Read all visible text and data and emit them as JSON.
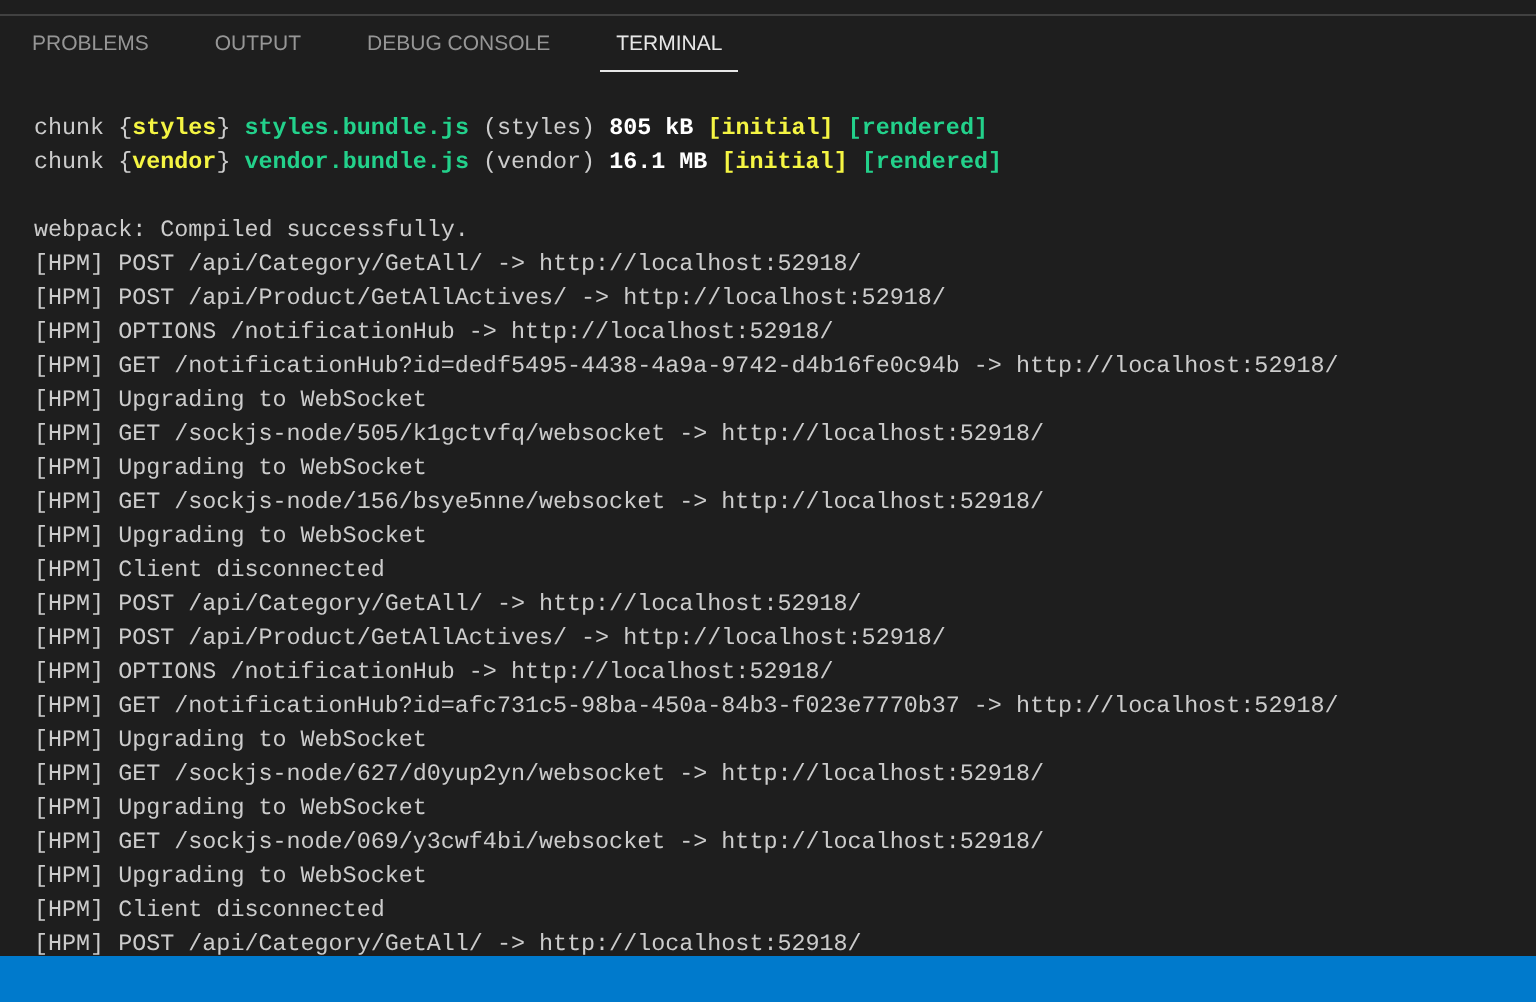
{
  "panel_tabs": [
    {
      "label": "PROBLEMS",
      "selected": false
    },
    {
      "label": "OUTPUT",
      "selected": false
    },
    {
      "label": "DEBUG CONSOLE",
      "selected": false
    },
    {
      "label": "TERMINAL",
      "selected": true
    }
  ],
  "terminal": {
    "blocks": [
      [
        [
          {
            "text": "chunk {",
            "kind": "plain"
          },
          {
            "text": "styles",
            "kind": "name"
          },
          {
            "text": "} ",
            "kind": "plain"
          },
          {
            "text": "styles.bundle.js",
            "kind": "file"
          },
          {
            "text": " (styles) ",
            "kind": "plain"
          },
          {
            "text": "805 kB",
            "kind": "size"
          },
          {
            "text": " [initial]",
            "kind": "initial"
          },
          {
            "text": " [rendered]",
            "kind": "rendered"
          }
        ],
        [
          {
            "text": "chunk {",
            "kind": "plain"
          },
          {
            "text": "vendor",
            "kind": "name"
          },
          {
            "text": "} ",
            "kind": "plain"
          },
          {
            "text": "vendor.bundle.js",
            "kind": "file"
          },
          {
            "text": " (vendor) ",
            "kind": "plain"
          },
          {
            "text": "16.1 MB",
            "kind": "size"
          },
          {
            "text": " [initial]",
            "kind": "initial"
          },
          {
            "text": " [rendered]",
            "kind": "rendered"
          }
        ]
      ],
      [
        [
          {
            "text": "webpack: Compiled successfully.",
            "kind": "plain"
          }
        ],
        [
          {
            "text": "[HPM] POST /api/Category/GetAll/ -> http://localhost:52918/",
            "kind": "plain"
          }
        ],
        [
          {
            "text": "[HPM] POST /api/Product/GetAllActives/ -> http://localhost:52918/",
            "kind": "plain"
          }
        ],
        [
          {
            "text": "[HPM] OPTIONS /notificationHub -> http://localhost:52918/",
            "kind": "plain"
          }
        ],
        [
          {
            "text": "[HPM] GET /notificationHub?id=dedf5495-4438-4a9a-9742-d4b16fe0c94b -> http://localhost:52918/",
            "kind": "plain"
          }
        ],
        [
          {
            "text": "[HPM] Upgrading to WebSocket",
            "kind": "plain"
          }
        ],
        [
          {
            "text": "[HPM] GET /sockjs-node/505/k1gctvfq/websocket -> http://localhost:52918/",
            "kind": "plain"
          }
        ],
        [
          {
            "text": "[HPM] Upgrading to WebSocket",
            "kind": "plain"
          }
        ],
        [
          {
            "text": "[HPM] GET /sockjs-node/156/bsye5nne/websocket -> http://localhost:52918/",
            "kind": "plain"
          }
        ],
        [
          {
            "text": "[HPM] Upgrading to WebSocket",
            "kind": "plain"
          }
        ],
        [
          {
            "text": "[HPM] Client disconnected",
            "kind": "plain"
          }
        ],
        [
          {
            "text": "[HPM] POST /api/Category/GetAll/ -> http://localhost:52918/",
            "kind": "plain"
          }
        ],
        [
          {
            "text": "[HPM] POST /api/Product/GetAllActives/ -> http://localhost:52918/",
            "kind": "plain"
          }
        ],
        [
          {
            "text": "[HPM] OPTIONS /notificationHub -> http://localhost:52918/",
            "kind": "plain"
          }
        ],
        [
          {
            "text": "[HPM] GET /notificationHub?id=afc731c5-98ba-450a-84b3-f023e7770b37 -> http://localhost:52918/",
            "kind": "plain"
          }
        ],
        [
          {
            "text": "[HPM] Upgrading to WebSocket",
            "kind": "plain"
          }
        ],
        [
          {
            "text": "[HPM] GET /sockjs-node/627/d0yup2yn/websocket -> http://localhost:52918/",
            "kind": "plain"
          }
        ],
        [
          {
            "text": "[HPM] Upgrading to WebSocket",
            "kind": "plain"
          }
        ],
        [
          {
            "text": "[HPM] GET /sockjs-node/069/y3cwf4bi/websocket -> http://localhost:52918/",
            "kind": "plain"
          }
        ],
        [
          {
            "text": "[HPM] Upgrading to WebSocket",
            "kind": "plain"
          }
        ],
        [
          {
            "text": "[HPM] Client disconnected",
            "kind": "plain"
          }
        ],
        [
          {
            "text": "[HPM] POST /api/Category/GetAll/ -> http://localhost:52918/",
            "kind": "plain"
          }
        ]
      ]
    ]
  }
}
